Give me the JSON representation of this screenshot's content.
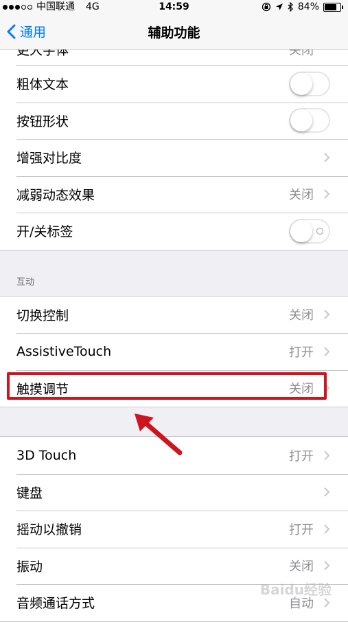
{
  "status_bar": {
    "carrier": "中国联通",
    "network": "4G",
    "time": "14:59",
    "battery": "84%",
    "battery_level": 0.84
  },
  "nav": {
    "back_label": "通用",
    "title": "辅助功能"
  },
  "group1": {
    "partial_label": "更大字体",
    "partial_value": "关闭",
    "items": [
      {
        "label": "粗体文本",
        "type": "toggle"
      },
      {
        "label": "按钮形状",
        "type": "toggle"
      },
      {
        "label": "增强对比度",
        "type": "chevron"
      },
      {
        "label": "减弱动态效果",
        "value": "关闭",
        "type": "chevron"
      },
      {
        "label": "开/关标签",
        "type": "toggle"
      }
    ]
  },
  "section_interaction": {
    "header": "互动",
    "items": [
      {
        "label": "切换控制",
        "value": "关闭"
      },
      {
        "label": "AssistiveTouch",
        "value": "打开"
      },
      {
        "label": "触摸调节",
        "value": "关闭"
      }
    ]
  },
  "group3": {
    "items": [
      {
        "label": "3D Touch",
        "value": "打开"
      },
      {
        "label": "键盘",
        "value": ""
      },
      {
        "label": "摇动以撤销",
        "value": "打开"
      },
      {
        "label": "振动",
        "value": "关闭"
      },
      {
        "label": "音频通话方式",
        "value": "自动"
      }
    ]
  },
  "watermark": "Baidu经验",
  "colors": {
    "accent": "#007aff",
    "highlight": "#d0141f",
    "background": "#efeff4"
  }
}
